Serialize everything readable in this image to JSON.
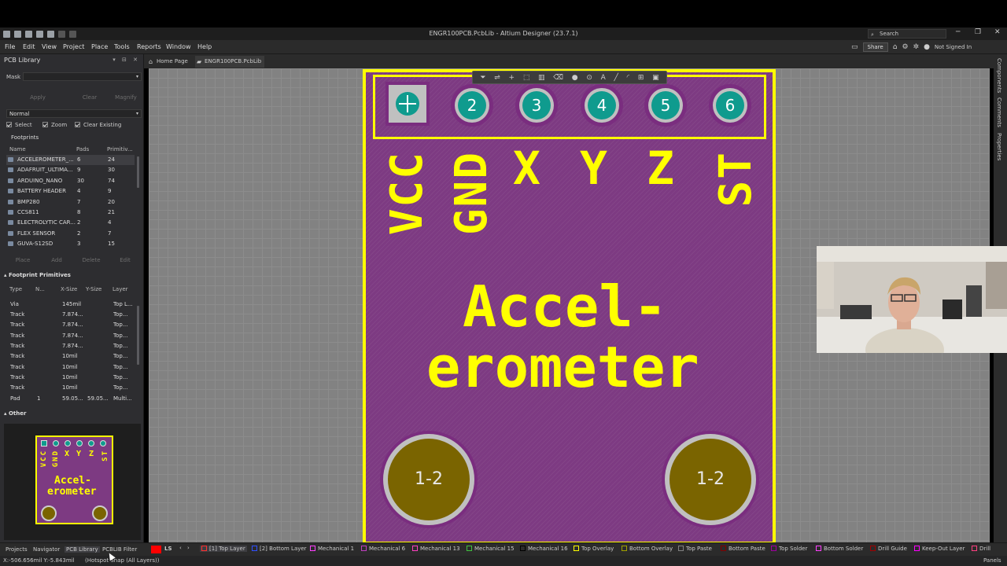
{
  "window": {
    "title": "ENGR100PCB.PcbLib - Altium Designer (23.7.1)",
    "search_placeholder": "Search"
  },
  "menu": {
    "items": [
      "File",
      "Edit",
      "View",
      "Project",
      "Place",
      "Tools",
      "Reports",
      "Window",
      "Help"
    ],
    "share": "Share",
    "account": "Not Signed In"
  },
  "tabs": {
    "home": "Home Page",
    "doc": "ENGR100PCB.PcbLib"
  },
  "left_panel": {
    "title": "PCB Library",
    "mask_label": "Mask",
    "buttons_top": [
      "Apply",
      "Clear",
      "Magnify"
    ],
    "mode": "Normal",
    "checkboxes": [
      "Select",
      "Zoom",
      "Clear Existing"
    ],
    "footprints_header": "Footprints",
    "footprint_columns": [
      "Name",
      "Pads",
      "Primitiv..."
    ],
    "footprints": [
      {
        "name": "ACCELEROMETER_...",
        "pads": "6",
        "prims": "24"
      },
      {
        "name": "ADAFRUIT_ULTIMA...",
        "pads": "9",
        "prims": "30"
      },
      {
        "name": "ARDUINO_NANO",
        "pads": "30",
        "prims": "74"
      },
      {
        "name": "BATTERY HEADER",
        "pads": "4",
        "prims": "9"
      },
      {
        "name": "BMP280",
        "pads": "7",
        "prims": "20"
      },
      {
        "name": "CCS811",
        "pads": "8",
        "prims": "21"
      },
      {
        "name": "ELECTROLYTIC CAR...",
        "pads": "2",
        "prims": "4"
      },
      {
        "name": "FLEX SENSOR",
        "pads": "2",
        "prims": "7"
      },
      {
        "name": "GUVA-S12SD",
        "pads": "3",
        "prims": "15"
      }
    ],
    "buttons_mid": [
      "Place",
      "Add",
      "Delete",
      "Edit"
    ],
    "primitives_header": "Footprint Primitives",
    "primitive_columns": [
      "Type",
      "N...",
      "X-Size",
      "Y-Size",
      "Layer"
    ],
    "primitives": [
      {
        "type": "Via",
        "n": "",
        "x": "145mil",
        "y": "",
        "layer": "Top L..."
      },
      {
        "type": "Track",
        "n": "",
        "x": "7.874...",
        "y": "",
        "layer": "Top..."
      },
      {
        "type": "Track",
        "n": "",
        "x": "7.874...",
        "y": "",
        "layer": "Top..."
      },
      {
        "type": "Track",
        "n": "",
        "x": "7.874...",
        "y": "",
        "layer": "Top..."
      },
      {
        "type": "Track",
        "n": "",
        "x": "7.874...",
        "y": "",
        "layer": "Top..."
      },
      {
        "type": "Track",
        "n": "",
        "x": "10mil",
        "y": "",
        "layer": "Top..."
      },
      {
        "type": "Track",
        "n": "",
        "x": "10mil",
        "y": "",
        "layer": "Top..."
      },
      {
        "type": "Track",
        "n": "",
        "x": "10mil",
        "y": "",
        "layer": "Top..."
      },
      {
        "type": "Track",
        "n": "",
        "x": "10mil",
        "y": "",
        "layer": "Top..."
      },
      {
        "type": "Pad",
        "n": "1",
        "x": "59.05...",
        "y": "59.05...",
        "layer": "Multi..."
      }
    ],
    "other_header": "Other",
    "preview": {
      "labels": [
        "VCC",
        "GND",
        "X",
        "Y",
        "Z",
        "ST"
      ],
      "line1": "Accel-",
      "line2": "erometer"
    }
  },
  "footprint": {
    "pads": [
      "2",
      "3",
      "4",
      "5",
      "6"
    ],
    "silk_labels": [
      "VCC",
      "GND",
      "X",
      "Y",
      "Z",
      "ST"
    ],
    "title_line1": "Accel-",
    "title_line2": "erometer",
    "mount_holes": [
      "1-2",
      "1-2"
    ]
  },
  "right_strip": [
    "Components",
    "Comments",
    "Properties"
  ],
  "bottom": {
    "panel_tabs": [
      "Projects",
      "Navigator",
      "PCB Library",
      "PCBLIB Filter"
    ],
    "ls": "LS",
    "layers": [
      {
        "name": "[1] Top Layer",
        "color": "#ff3030"
      },
      {
        "name": "[2] Bottom Layer",
        "color": "#3050ff"
      },
      {
        "name": "Mechanical 1",
        "color": "#ff40ff"
      },
      {
        "name": "Mechanical 6",
        "color": "#c040c0"
      },
      {
        "name": "Mechanical 13",
        "color": "#ff40c0"
      },
      {
        "name": "Mechanical 15",
        "color": "#40c040"
      },
      {
        "name": "Mechanical 16",
        "color": "#000000"
      },
      {
        "name": "Top Overlay",
        "color": "#ffff00"
      },
      {
        "name": "Bottom Overlay",
        "color": "#a0a000"
      },
      {
        "name": "Top Paste",
        "color": "#808080"
      },
      {
        "name": "Bottom Paste",
        "color": "#800000"
      },
      {
        "name": "Top Solder",
        "color": "#a000a0"
      },
      {
        "name": "Bottom Solder",
        "color": "#ff40ff"
      },
      {
        "name": "Drill Guide",
        "color": "#a00000"
      },
      {
        "name": "Keep-Out Layer",
        "color": "#ff00ff"
      },
      {
        "name": "Drill",
        "color": "#ff4080"
      }
    ],
    "panels": "Panels",
    "coords": "X:-506.656mil Y:-5.843mil",
    "snap": "(Hotspot Snap (All Layers))"
  }
}
